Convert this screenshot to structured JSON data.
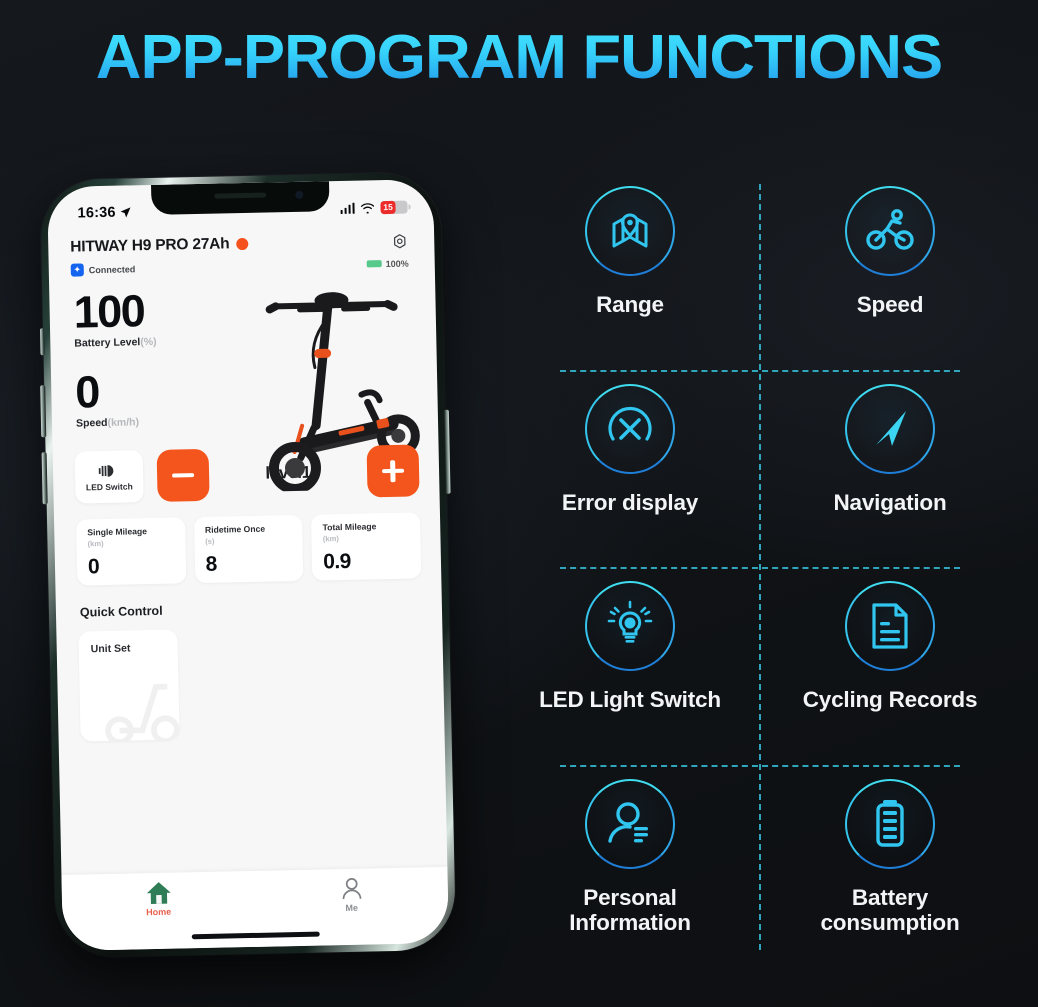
{
  "page": {
    "title": "APP-PROGRAM FUNCTIONS",
    "accent_cyan": "#46e4ff",
    "accent_blue": "#1f8fe0",
    "background": "#111418",
    "divider_color": "#2fa6bb"
  },
  "phone": {
    "statusbar": {
      "time": "16:36",
      "location_icon": "location-arrow-icon",
      "signal_icon": "cellular-signal-icon",
      "wifi_icon": "wifi-icon",
      "battery_level": "15"
    },
    "header": {
      "device_name": "HITWAY H9 PRO 27Ah",
      "status_dot": "#f4511e",
      "settings_icon": "gear-icon"
    },
    "connection": {
      "bluetooth_label": "Connected",
      "battery_label": "100%"
    },
    "metrics": [
      {
        "value": "100",
        "label": "Battery Level",
        "unit": "(%)"
      },
      {
        "value": "0",
        "label": "Speed",
        "unit": "(km/h)"
      }
    ],
    "controls": {
      "led_switch_label": "LED Switch",
      "minus_label": "-",
      "level_label": "level1",
      "plus_label": "+",
      "button_color": "#f4551d"
    },
    "stats": [
      {
        "title": "Single Mileage",
        "unit": "(km)",
        "value": "0"
      },
      {
        "title": "Ridetime Once",
        "unit": "(s)",
        "value": "8"
      },
      {
        "title": "Total Mileage",
        "unit": "(km)",
        "value": "0.9"
      }
    ],
    "quick_control": {
      "section_title": "Quick Control",
      "card_label": "Unit Set"
    },
    "tabbar": [
      {
        "label": "Home",
        "icon": "home-icon",
        "active": true
      },
      {
        "label": "Me",
        "icon": "person-icon",
        "active": false
      }
    ]
  },
  "features": [
    {
      "label": "Range",
      "icon": "map-pin-icon"
    },
    {
      "label": "Speed",
      "icon": "cyclist-icon"
    },
    {
      "label": "Error display",
      "icon": "error-x-gauge-icon"
    },
    {
      "label": "Navigation",
      "icon": "navigation-arrow-icon"
    },
    {
      "label": "LED Light Switch",
      "icon": "lightbulb-icon"
    },
    {
      "label": "Cycling Records",
      "icon": "document-icon"
    },
    {
      "label": "Personal\nInformation",
      "icon": "person-info-icon",
      "line1": "Personal",
      "line2": "Information"
    },
    {
      "label": "Battery\nconsumption",
      "icon": "battery-icon",
      "line1": "Battery",
      "line2": "consumption"
    }
  ]
}
